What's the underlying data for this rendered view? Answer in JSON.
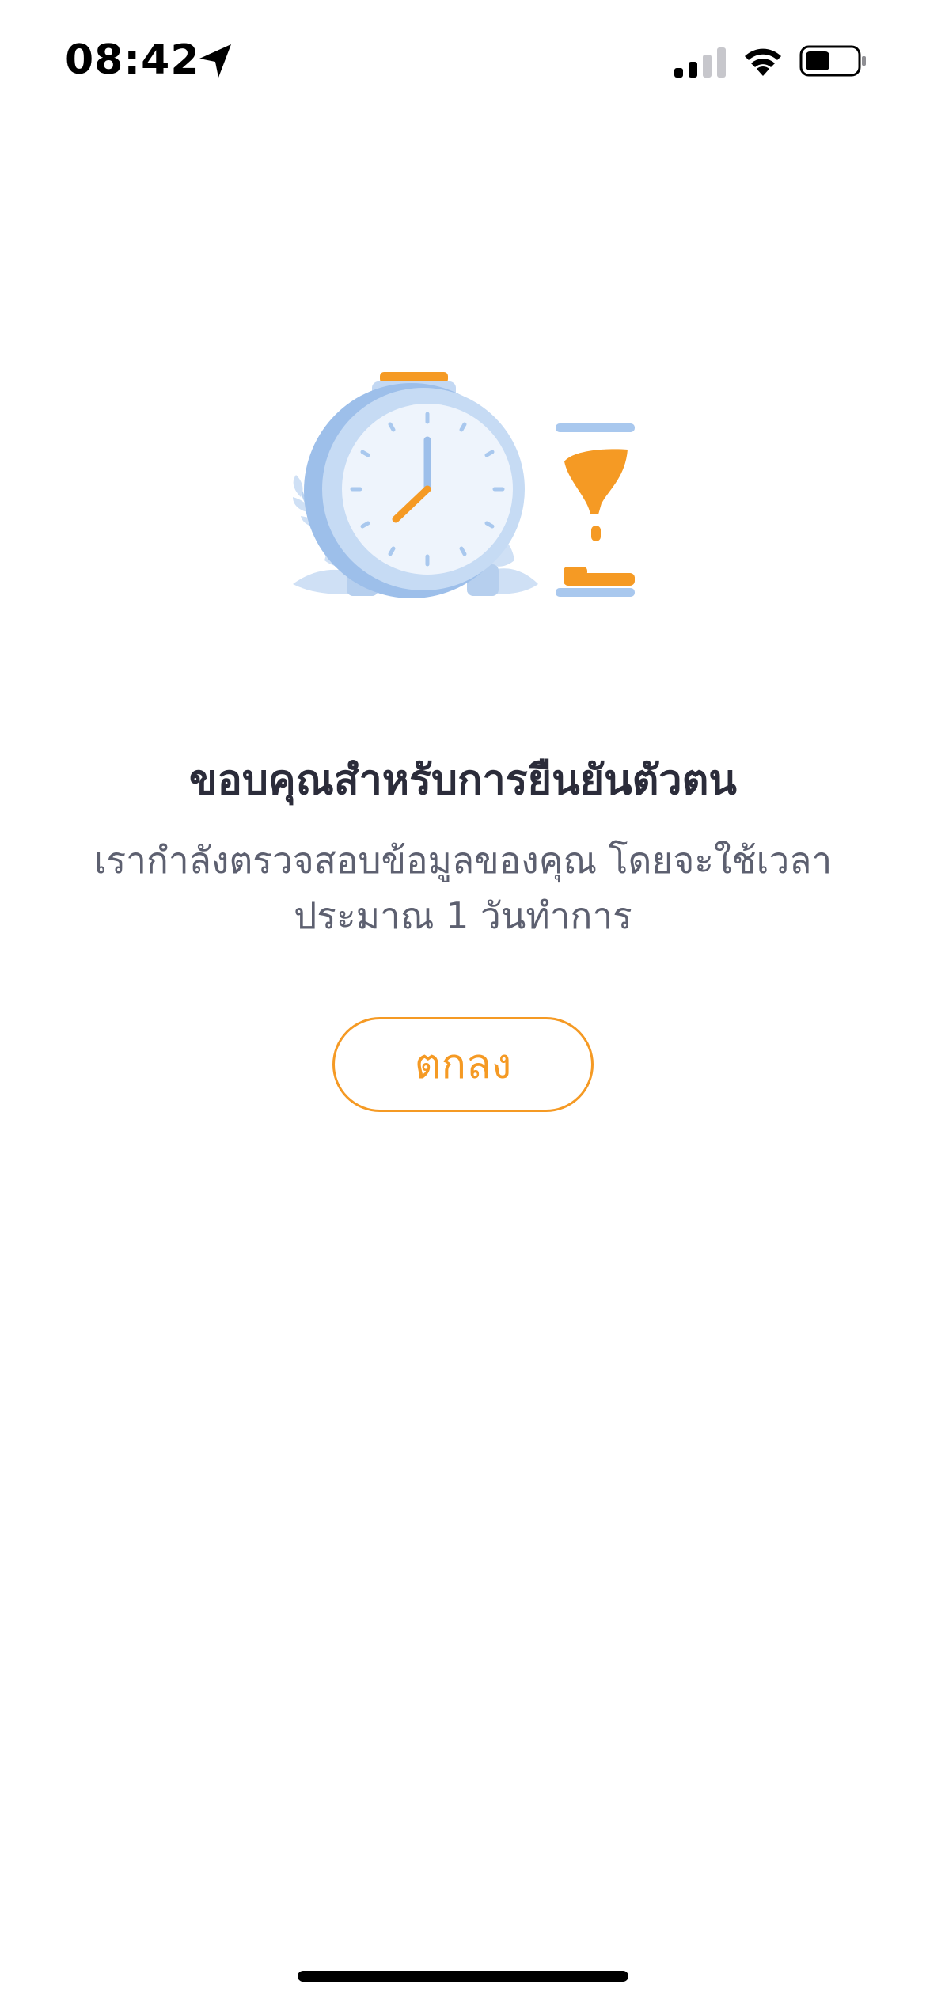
{
  "status_bar": {
    "time": "08:42",
    "icons": [
      "location-arrow-icon",
      "cellular-signal-icon",
      "wifi-icon",
      "battery-icon"
    ]
  },
  "illustration": {
    "icons": [
      "alarm-clock-icon",
      "hourglass-icon",
      "leaf-icon"
    ]
  },
  "content": {
    "title": "ขอบคุณสำหรับการยืนยันตัวตน",
    "subtitle": "เรากำลังตรวจสอบข้อมูลของคุณ โดยจะใช้เวลาประมาณ 1 วันทำการ"
  },
  "actions": {
    "ok_label": "ตกลง"
  },
  "colors": {
    "accent": "#f59a24",
    "clock_blue": "#a9c8ee",
    "title_text": "#2b2c3a",
    "body_text": "#5d6070"
  }
}
